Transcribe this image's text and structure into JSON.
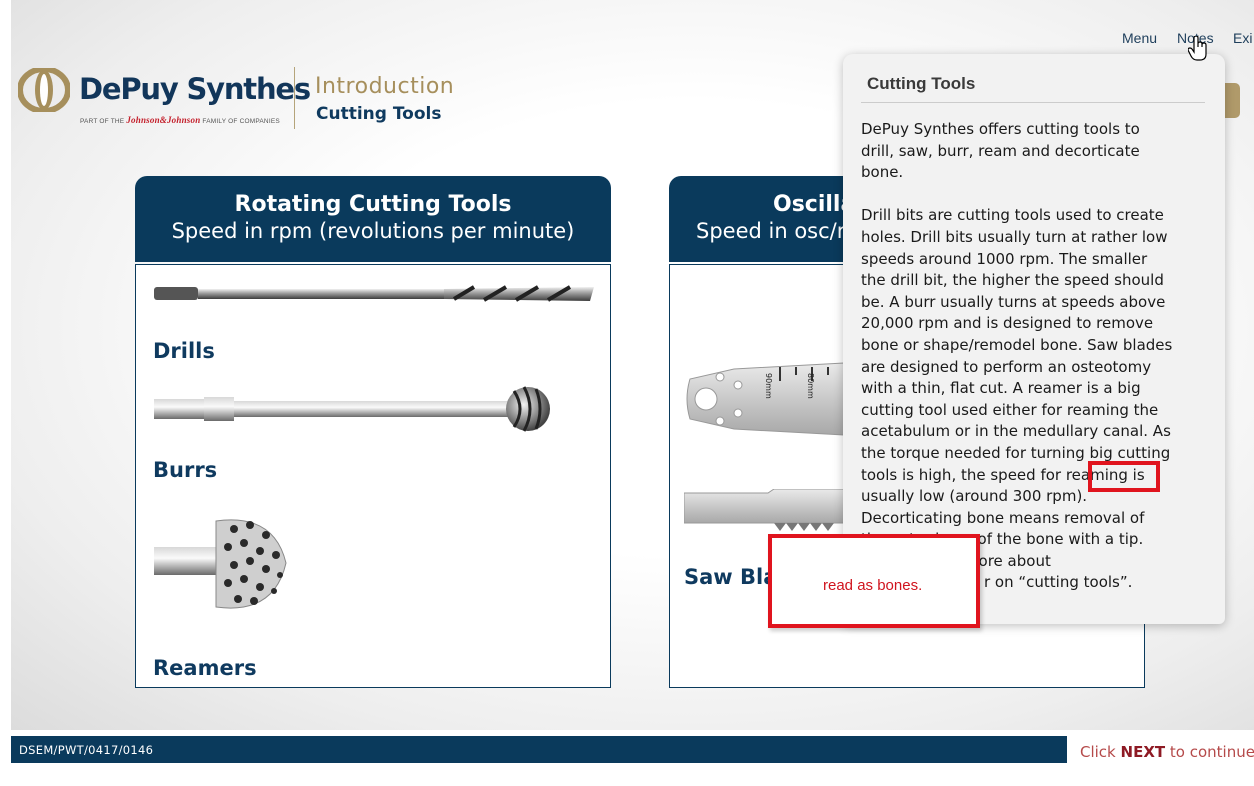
{
  "nav": {
    "menu": "Menu",
    "notes": "Notes",
    "exit": "Exi"
  },
  "header": {
    "brand": "DePuy Synthes",
    "tagline_pre": "PART OF THE",
    "tagline_jj": "Johnson&Johnson",
    "tagline_post": "FAMILY OF COMPANIES",
    "title": "Introduction",
    "subtitle": "Cutting Tools"
  },
  "left_panel": {
    "title": "Rotating Cutting Tools",
    "subtitle": "Speed in rpm (revolutions per minute)",
    "items": [
      "Drills",
      "Burrs",
      "Reamers"
    ]
  },
  "right_panel": {
    "title": "Oscilla",
    "subtitle": "Speed in osc/r",
    "items": [
      "Saw Bla"
    ],
    "ruler_labels": [
      "90mm",
      "80mm"
    ]
  },
  "notes": {
    "title": "Cutting Tools",
    "para1": "DePuy Synthes offers cutting tools to drill, saw, burr, ream and decorticate bone.",
    "para2": "Drill bits are cutting tools used to create holes. Drill bits usually turn at rather low speeds around 1000 rpm. The smaller the drill bit, the higher the speed should be. A burr usually turns at speeds above 20,000 rpm and is designed to remove bone or shape/remodel bone. Saw blades are designed to perform an osteotomy with a thin, flat cut. A reamer is a big cutting tool used either for reaming the acetabulum or in the medullary canal. As the torque needed for turning big cutting tools is high, the speed for reaming is usually low (around 300 rpm). Decorticating bone means removal of the outer layer of the bone with a tip. You will learn more about",
    "para2_tail": "r on “cutting tools”."
  },
  "annotation": {
    "comment": "read as bones."
  },
  "footer": {
    "code": "DSEM/PWT/0417/0146",
    "cta_pre": "Click",
    "cta_next": "NEXT",
    "cta_post": "to continue."
  },
  "colors": {
    "navy": "#0a3a5c",
    "gold": "#a68f5c",
    "annotation_red": "#e0141e"
  }
}
